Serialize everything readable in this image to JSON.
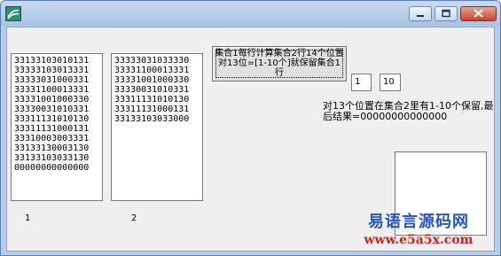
{
  "window": {
    "title": ""
  },
  "lists": {
    "set1": {
      "label": "1",
      "items": [
        "33133103010131",
        "33333103013331",
        "33333031000331",
        "33331100013331",
        "33331001000330",
        "33330031010331",
        "33311131010130",
        "33311131000131",
        "33310003003331",
        "33133130003130",
        "33133103033130",
        "00000000000000"
      ]
    },
    "set2": {
      "label": "2",
      "items": [
        "33333031033330",
        "33331100013331",
        "33331001000330",
        "33330031010331",
        "33311131010130",
        "33311131000131",
        "33133103033000"
      ]
    }
  },
  "button": {
    "label": "集合1每行计算集合2行14个位置对13位=[1-10个]就保留集合1行"
  },
  "fields": {
    "min_value": "1",
    "max_value": "10"
  },
  "result": {
    "text": "对13个位置在集合2里有1-10个保留,最后结果=00000000000000"
  },
  "watermark": {
    "name": "易语言源码网",
    "url": "www.e5a5x.com"
  }
}
